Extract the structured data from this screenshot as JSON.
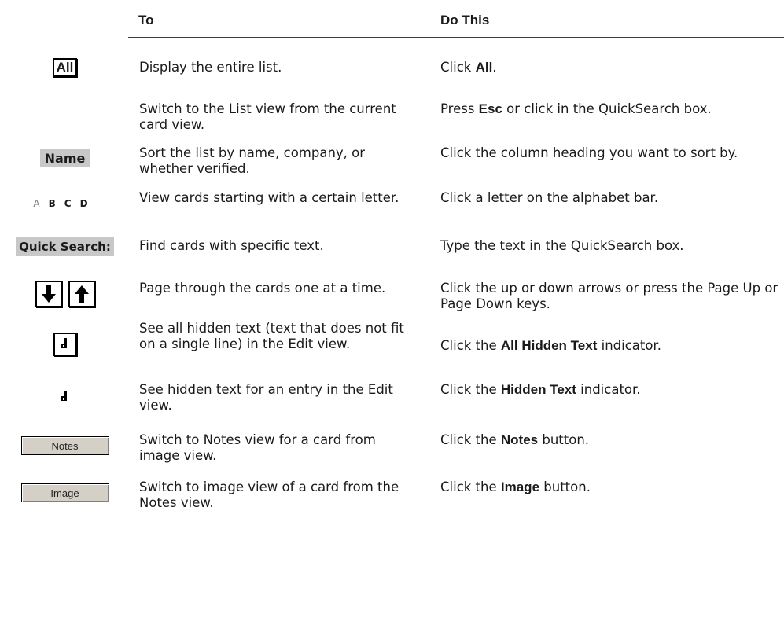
{
  "header": {
    "col_to": "To",
    "col_do": "Do This"
  },
  "rows": [
    {
      "icon": "all-button-icon",
      "icon_text": "All",
      "to": "Display the entire list.",
      "do_pre": "Click ",
      "do_bold": "All",
      "do_post": "."
    },
    {
      "icon": "",
      "to": "Switch to the List view from the current card view.",
      "do_pre": "Press ",
      "do_bold": "Esc",
      "do_post": " or click in the QuickSearch box."
    },
    {
      "icon": "name-column-heading-icon",
      "icon_text": "Name",
      "to": "Sort the list by name, company, or whether verified.",
      "do_pre": "Click the column heading you want to sort by.",
      "do_bold": "",
      "do_post": ""
    },
    {
      "icon": "alphabet-bar-icon",
      "icon_letters": [
        "A",
        "B",
        "C",
        "D"
      ],
      "to": "View cards starting with a certain letter.",
      "do_pre": "Click a letter on the alphabet bar.",
      "do_bold": "",
      "do_post": ""
    },
    {
      "icon": "quick-search-label-icon",
      "icon_text": "Quick Search:",
      "to": "Find cards with specific text.",
      "do_pre": "Type the text in the QuickSearch box.",
      "do_bold": "",
      "do_post": ""
    },
    {
      "icon": "page-arrows-icon",
      "icon_glyphs": [
        "🡇",
        "🡅"
      ],
      "to": "Page through the cards one at a time.",
      "do_pre": "Click the up or down arrows or press the Page Up or Page Down keys.",
      "do_bold": "",
      "do_post": ""
    },
    {
      "icon": "all-hidden-text-icon",
      "icon_glyph": "ꓒ",
      "to": "See all hidden text (text that does not fit on a single line) in the Edit view.",
      "do_pre": "Click the ",
      "do_bold": "All Hidden Text",
      "do_post": " indicator."
    },
    {
      "icon": "hidden-text-icon",
      "icon_glyph": "ꓒ",
      "to": "See hidden text for an entry in the Edit view.",
      "do_pre": "Click the ",
      "do_bold": "Hidden Text",
      "do_post": " indicator."
    },
    {
      "icon": "notes-button-icon",
      "icon_text": "Notes",
      "to": "Switch to Notes view for a card from image view.",
      "do_pre": "Click the ",
      "do_bold": "Notes",
      "do_post": " button."
    },
    {
      "icon": "image-button-icon",
      "icon_text": "Image",
      "to": "Switch to image view of a card from the Notes view.",
      "do_pre": "Click the ",
      "do_bold": "Image",
      "do_post": " button."
    }
  ]
}
